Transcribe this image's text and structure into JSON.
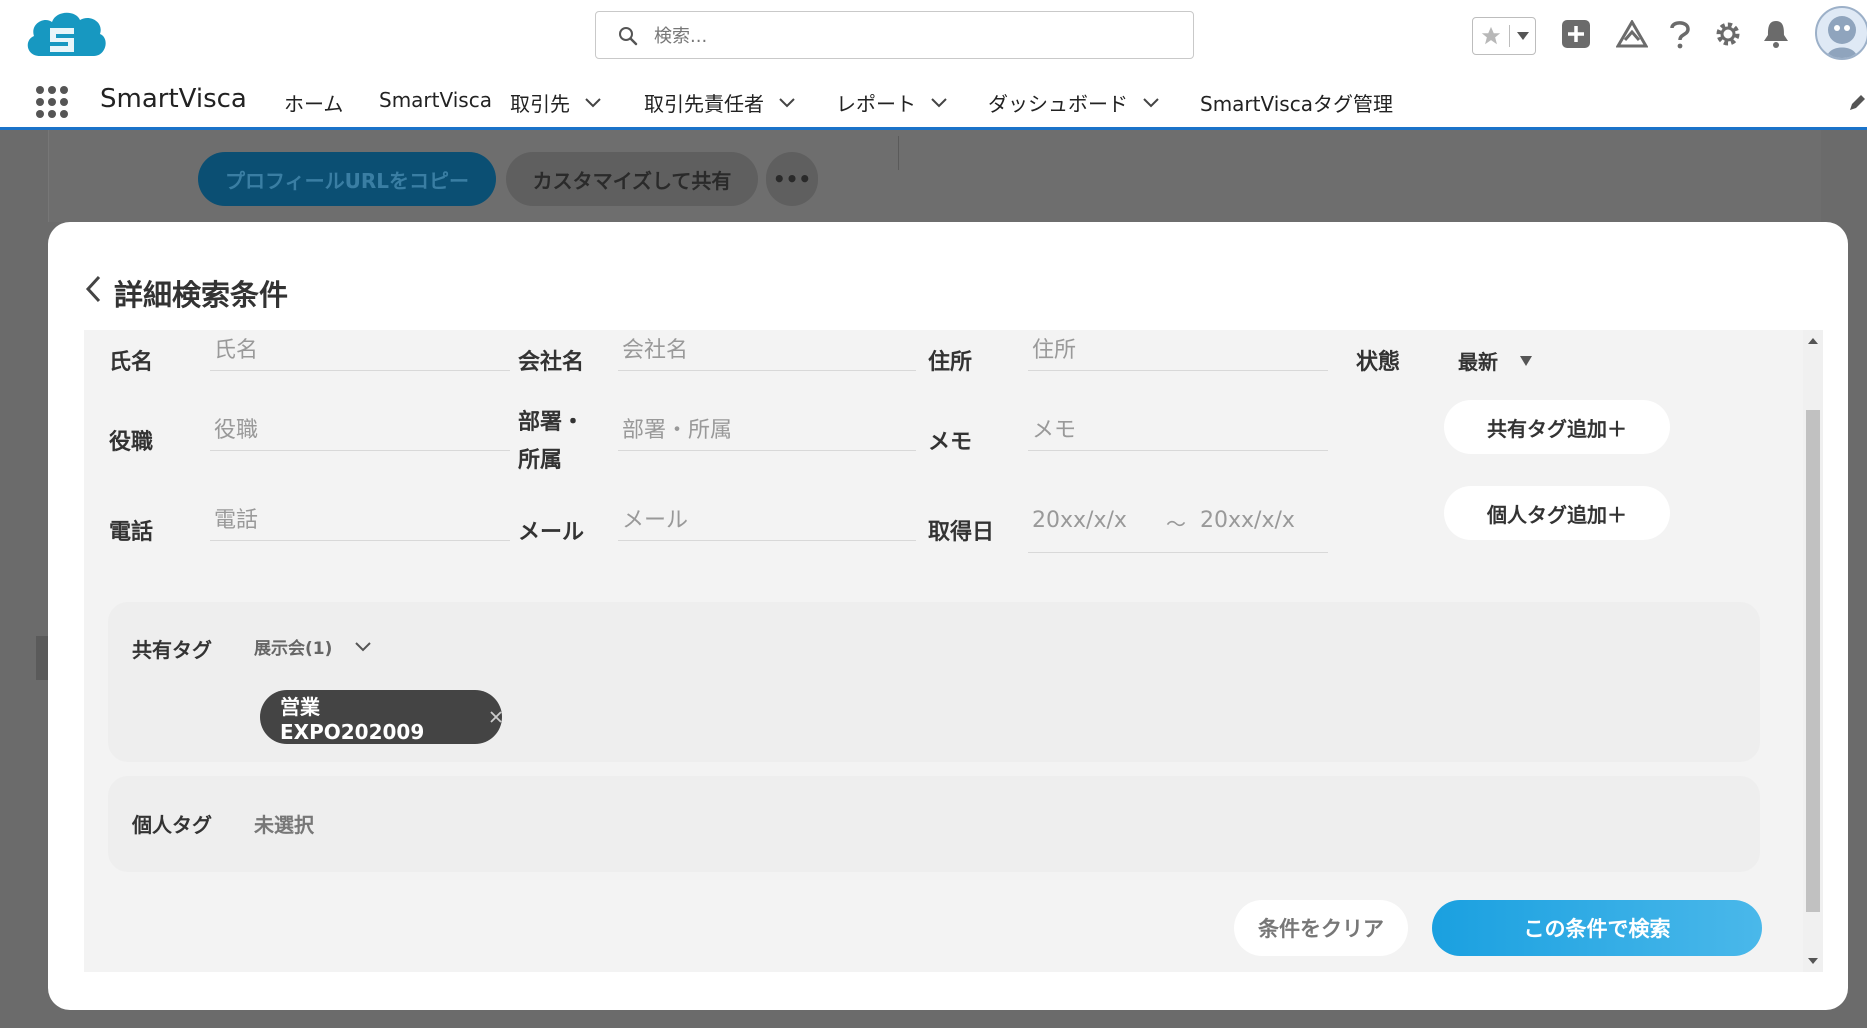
{
  "global": {
    "search_placeholder": "検索..."
  },
  "nav": {
    "app_name": "SmartVisca",
    "items": [
      {
        "label": "ホーム",
        "has_menu": false
      },
      {
        "label": "SmartVisca",
        "has_menu": false
      },
      {
        "label": "取引先",
        "has_menu": true
      },
      {
        "label": "取引先責任者",
        "has_menu": true
      },
      {
        "label": "レポート",
        "has_menu": true
      },
      {
        "label": "ダッシュボード",
        "has_menu": true
      },
      {
        "label": "SmartViscaタグ管理",
        "has_menu": false
      }
    ]
  },
  "background_page": {
    "copy_profile_label": "プロフィールURLをコピー",
    "customize_share_label": "カスタマイズして共有",
    "more_label": "•••"
  },
  "modal": {
    "title": "詳細検索条件",
    "fields": {
      "name": {
        "label": "氏名",
        "placeholder": "氏名"
      },
      "company": {
        "label": "会社名",
        "placeholder": "会社名"
      },
      "address": {
        "label": "住所",
        "placeholder": "住所"
      },
      "state": {
        "label": "状態",
        "value": "最新"
      },
      "title": {
        "label": "役職",
        "placeholder": "役職"
      },
      "department": {
        "label_line1": "部署・",
        "label_line2": "所属",
        "placeholder": "部署・所属"
      },
      "memo": {
        "label": "メモ",
        "placeholder": "メモ"
      },
      "phone": {
        "label": "電話",
        "placeholder": "電話"
      },
      "email": {
        "label": "メール",
        "placeholder": "メール"
      },
      "acquired": {
        "label": "取得日",
        "from_placeholder": "20xx/x/x",
        "separator": "～",
        "to_placeholder": "20xx/x/x"
      }
    },
    "add_shared_tag_label": "共有タグ追加＋",
    "add_personal_tag_label": "個人タグ追加＋",
    "shared_tags": {
      "label": "共有タグ",
      "selection": "展示会(1)",
      "chips": [
        "営業EXPO202009"
      ]
    },
    "personal_tags": {
      "label": "個人タグ",
      "selection": "未選択"
    },
    "clear_label": "条件をクリア",
    "search_label": "この条件で検索"
  },
  "colors": {
    "brand_blue": "#1b73c9",
    "search_button": "#1aa0e0",
    "chip_bg": "#444444"
  }
}
